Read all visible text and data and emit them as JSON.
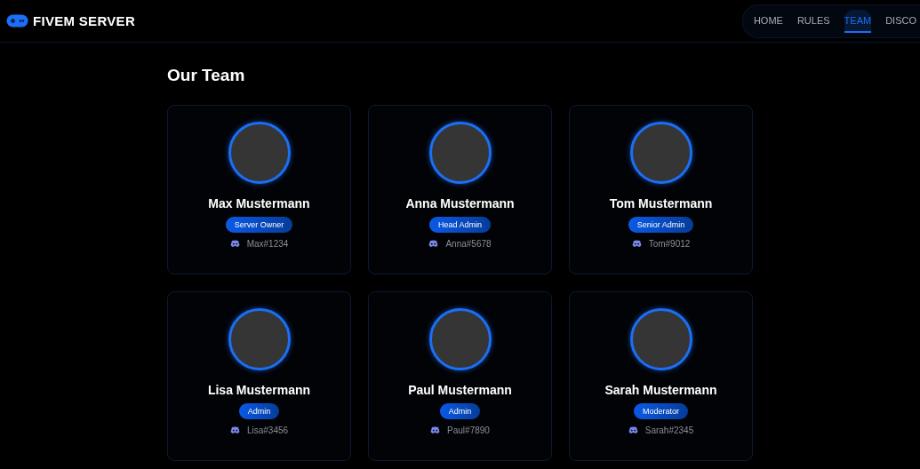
{
  "brand": {
    "title": "FIVEM SERVER"
  },
  "nav": [
    {
      "label": "HOME",
      "selected": false
    },
    {
      "label": "RULES",
      "selected": false
    },
    {
      "label": "TEAM",
      "selected": true
    },
    {
      "label": "DISCO",
      "selected": false
    }
  ],
  "section_title": "Our Team",
  "members": [
    {
      "name": "Max Mustermann",
      "role": "Server Owner",
      "discord": "Max#1234"
    },
    {
      "name": "Anna Mustermann",
      "role": "Head Admin",
      "discord": "Anna#5678"
    },
    {
      "name": "Tom Mustermann",
      "role": "Senior Admin",
      "discord": "Tom#9012"
    },
    {
      "name": "Lisa Mustermann",
      "role": "Admin",
      "discord": "Lisa#3456"
    },
    {
      "name": "Paul Mustermann",
      "role": "Admin",
      "discord": "Paul#7890"
    },
    {
      "name": "Sarah Mustermann",
      "role": "Moderator",
      "discord": "Sarah#2345"
    }
  ]
}
